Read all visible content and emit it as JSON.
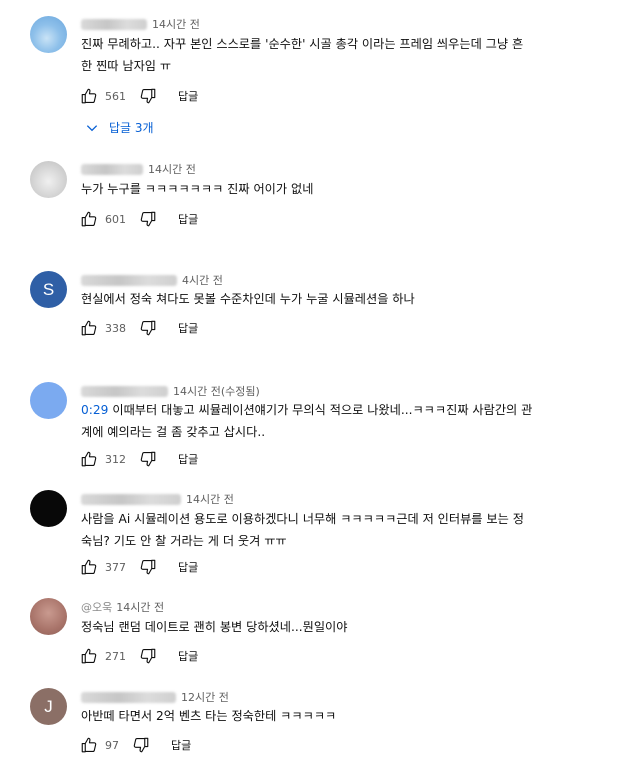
{
  "comments": [
    {
      "handle": "@",
      "time": "14시간 전",
      "text": "진짜 무례하고.. 자꾸 본인 스스로를 '순수한' 시골 총각 이라는 프레임 씌우는데 그냥 흔\n한 찐따 남자임 ㅠ",
      "likes": "561",
      "reply_label": "답글",
      "replies_label": "답글 3개",
      "avatar_color": "#7fb6e6"
    },
    {
      "handle": "@",
      "time": "14시간 전",
      "text": "누가 누구를 ㅋㅋㅋㅋㅋㅋㅋ 진짜 어이가 없네",
      "likes": "601",
      "reply_label": "답글",
      "avatar_color": "#d8d8d8"
    },
    {
      "handle": "@",
      "time": "4시간 전",
      "text": "현실에서 정숙 쳐다도 못볼 수준차인데 누가 누굴 시뮬레션을 하나",
      "likes": "338",
      "reply_label": "답글",
      "avatar_letter": "S",
      "avatar_color": "#2f5fa6"
    },
    {
      "handle": "@",
      "time": "14시간 전(수정됨)",
      "timestamp": "0:29",
      "text": "이때부터 대놓고 씨뮬레이션얘기가 무의식 적으로 나왔네...ㅋㅋㅋ진짜 사람간의 관\n계에 예의라는 걸 좀 갖추고 삽시다..",
      "likes": "312",
      "reply_label": "답글",
      "avatar_color": "#7baaf0"
    },
    {
      "handle": "@",
      "time": "14시간 전",
      "text": "사람을 Ai 시뮬레이션 용도로 이용하겠다니 너무해 ㅋㅋㅋㅋㅋ근데 저 인터뷰를 보는 정\n숙님? 기도 안 찰 거라는 게 더 웃겨 ㅠㅠ",
      "likes": "377",
      "reply_label": "답글",
      "avatar_color": "#080808"
    },
    {
      "handle": "@오욱",
      "time": "14시간 전",
      "text": "정숙님 랜덤 데이트로 괜히 봉변 당하셨네...뭔일이야",
      "likes": "271",
      "reply_label": "답글",
      "avatar_color": "#b08078"
    },
    {
      "handle": "@",
      "time": "12시간 전",
      "text": "아반떼 타면서 2억 벤츠 타는 정숙한테 ㅋㅋㅋㅋㅋ",
      "likes": "97",
      "reply_label": "답글",
      "avatar_letter": "J",
      "avatar_color": "#8b6f66"
    }
  ]
}
